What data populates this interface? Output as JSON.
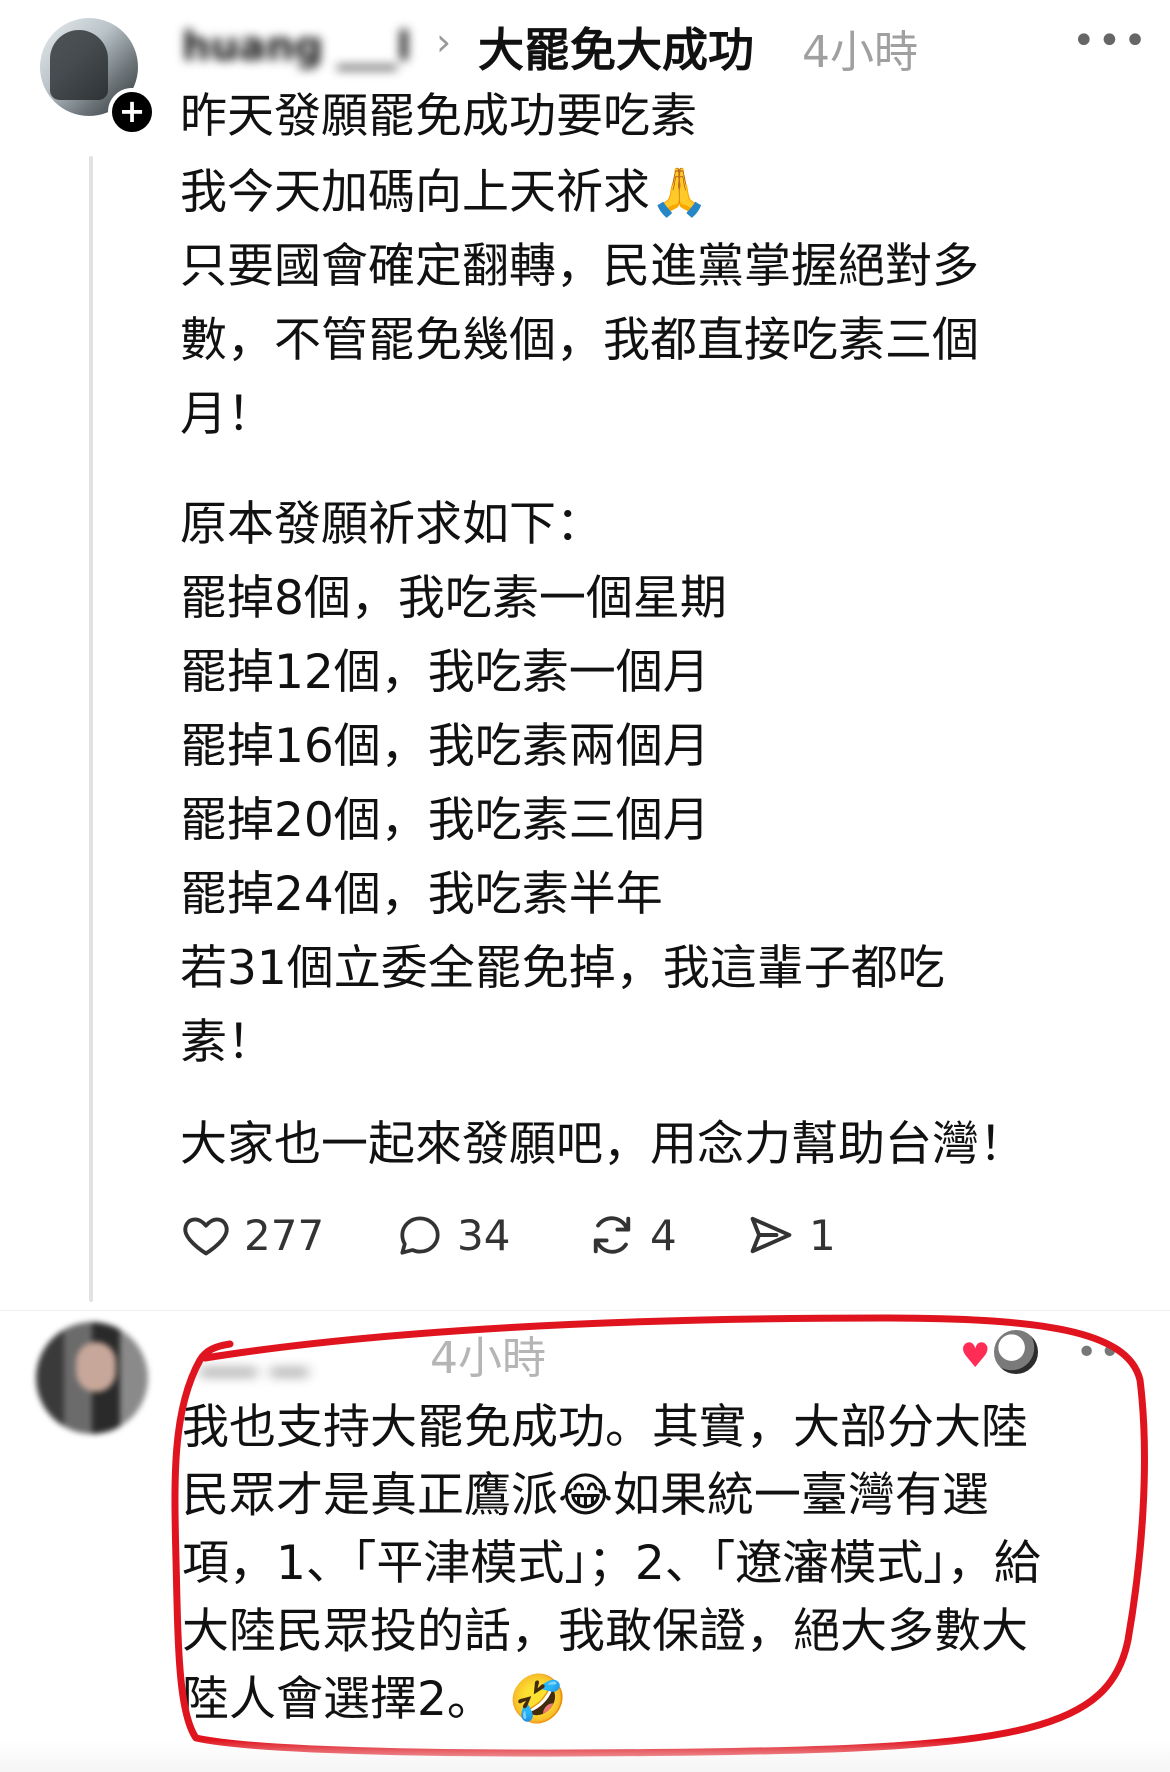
{
  "post": {
    "username": "huang ___l",
    "topic": "大罷免大成功",
    "time": "4小時",
    "more": "•••",
    "follow_icon": "plus-icon",
    "lines_group1": [
      "昨天發願罷免成功要吃素"
    ],
    "lines_group2": [
      "我今天加碼向上天祈求🙏",
      "只要國會確定翻轉，民進黨掌握絕對多",
      "數，不管罷免幾個，我都直接吃素三個",
      "月！"
    ],
    "lines_group3": [
      "原本發願祈求如下：",
      "罷掉8個，我吃素一個星期",
      "罷掉12個，我吃素一個月",
      "罷掉16個，我吃素兩個月",
      "罷掉20個，我吃素三個月",
      "罷掉24個，我吃素半年",
      "若31個立委全罷免掉，我這輩子都吃",
      "素！"
    ],
    "lines_group4": [
      "大家也一起來發願吧，用念力幫助台灣！"
    ],
    "stats": {
      "likes": "277",
      "comments": "34",
      "reposts": "4",
      "shares": "1"
    }
  },
  "reply": {
    "username": "___ __",
    "time": "4小時",
    "more": "••",
    "heart": "♥",
    "lines": [
      "我也支持大罷免成功。其實，大部分大陸",
      "民眾才是真正鷹派😂如果統一臺灣有選",
      "項，1、「平津模式」；2、「遼瀋模式」，給",
      "大陸民眾投的話，我敢保證，絕大多數大",
      "陸人會選擇2。 🤣"
    ]
  },
  "annotation_color": "#e0141e",
  "accent_like": "#ff2d55"
}
